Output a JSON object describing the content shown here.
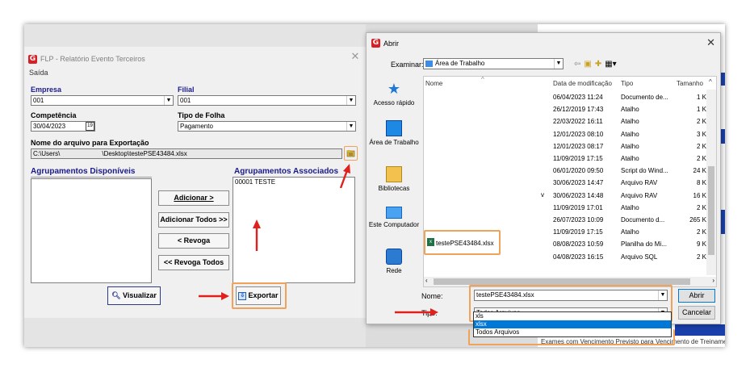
{
  "flp": {
    "title": "FLP - Relatório Evento Terceiros",
    "menu": "Saída",
    "empresa_label": "Empresa",
    "empresa_value": "001",
    "filial_label": "Filial",
    "filial_value": "001",
    "competencia_label": "Competência",
    "competencia_value": "30/04/2023",
    "tipo_folha_label": "Tipo de Folha",
    "tipo_folha_value": "Pagamento",
    "arquivo_label": "Nome do arquivo para Exportação",
    "arquivo_path_start": "C:\\Users\\",
    "arquivo_path_end": "\\Desktop\\testePSE43484.xlsx",
    "grp_disp_title": "Agrupamentos Disponíveis",
    "grp_assoc_title": "Agrupamentos Associados",
    "grp_assoc_items": [
      "00001 TESTE"
    ],
    "btn_adicionar": "Adicionar >",
    "btn_adicionar_todos": "Adicionar Todos >>",
    "btn_revoga": "< Revoga",
    "btn_revoga_todos": "<< Revoga Todos",
    "btn_visualizar": "Visualizar",
    "btn_exportar": "Exportar"
  },
  "dialog": {
    "title": "Abrir",
    "examinar_label": "Examinar:",
    "examinar_value": "Área de Trabalho",
    "sidebar": [
      "Acesso rápido",
      "Área de Trabalho",
      "Bibliotecas",
      "Este Computador",
      "Rede"
    ],
    "columns": [
      "Nome",
      "Data de modificação",
      "Tipo",
      "Tamanho"
    ],
    "rows": [
      {
        "date": "06/04/2023 11:24",
        "type": "Documento de...",
        "size": "1 K"
      },
      {
        "date": "26/12/2019 17:43",
        "type": "Atalho",
        "size": "1 K"
      },
      {
        "date": "22/03/2022 16:11",
        "type": "Atalho",
        "size": "2 K"
      },
      {
        "date": "12/01/2023 08:10",
        "type": "Atalho",
        "size": "3 K"
      },
      {
        "date": "12/01/2023 08:17",
        "type": "Atalho",
        "size": "2 K"
      },
      {
        "date": "11/09/2019 17:15",
        "type": "Atalho",
        "size": "2 K"
      },
      {
        "date": "06/01/2020 09:50",
        "type": "Script do Wind...",
        "size": "24 K"
      },
      {
        "date": "30/06/2023 14:47",
        "type": "Arquivo RAV",
        "size": "8 K"
      },
      {
        "date": "30/06/2023 14:48",
        "type": "Arquivo RAV",
        "size": "16 K"
      },
      {
        "date": "11/09/2019 17:01",
        "type": "Atalho",
        "size": "2 K"
      },
      {
        "date": "26/07/2023 10:09",
        "type": "Documento d...",
        "size": "265 K"
      },
      {
        "date": "11/09/2019 17:15",
        "type": "Atalho",
        "size": "2 K"
      },
      {
        "date": "08/08/2023 10:59",
        "type": "Planilha do Mi...",
        "size": "9 K"
      },
      {
        "date": "04/08/2023 16:15",
        "type": "Arquivo SQL",
        "size": "2 K"
      }
    ],
    "file_name": "testePSE43484.xlsx",
    "nome_label": "Nome:",
    "nome_value": "testePSE43484.xlsx",
    "tipo_label": "Tipo:",
    "tipo_value": "Todos Arquivos",
    "tipo_options": [
      "xls",
      "xlsx",
      "Todos Arquivos"
    ],
    "btn_abrir": "Abrir",
    "btn_cancelar": "Cancelar"
  },
  "background": {
    "bottom_text_1": "Exames com Vencimento Previsto para",
    "bottom_text_2": "Vencimento de Treinamen"
  },
  "colors": {
    "label_blue": "#1a1a8c",
    "highlight_orange": "#f0a15a",
    "arrow_red": "#e0201c",
    "selection_blue": "#0078d7"
  }
}
